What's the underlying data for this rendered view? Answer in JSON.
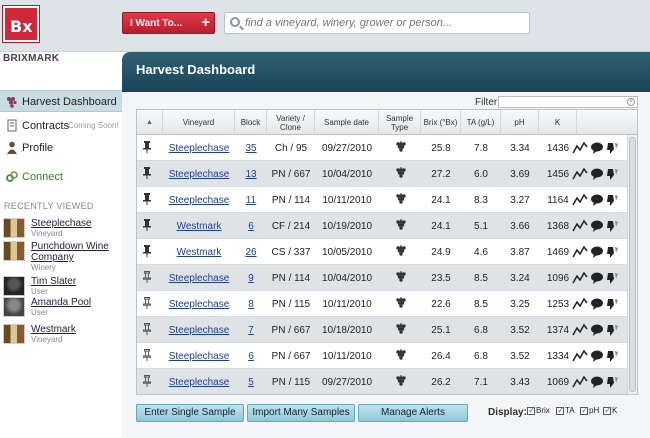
{
  "app": {
    "logo_text": "Bx",
    "brand": "BRIXMARK"
  },
  "topbar": {
    "i_want_label": "I Want To...",
    "i_want_plus": "+",
    "search_placeholder": "find a vineyard, winery, grower or person..."
  },
  "sidebar": {
    "items": [
      {
        "label": "Harvest Dashboard",
        "active": true,
        "icon": "grape-icon"
      },
      {
        "label": "Contracts",
        "badge": "Coming Soon!",
        "icon": "document-icon"
      },
      {
        "label": "Profile",
        "icon": "person-icon"
      },
      {
        "label": "Connect",
        "icon": "link-icon"
      }
    ],
    "recently_viewed_title": "RECENTLY VIEWED",
    "recent": [
      {
        "name": "Steeplechase",
        "type": "Vineyard"
      },
      {
        "name": "Punchdown Wine Company",
        "type": "Winery"
      },
      {
        "name": "Tim Slater",
        "type": "User"
      },
      {
        "name": "Amanda Pool",
        "type": "User"
      },
      {
        "name": "Westmark",
        "type": "Vineyard"
      }
    ]
  },
  "main": {
    "title": "Harvest Dashboard",
    "filter_label": "Filter:",
    "columns": [
      "Vineyard",
      "Block",
      "Variety / Clone",
      "Sample date",
      "Sample Type",
      "Brix (°Bx)",
      "TA (g/L)",
      "pH",
      "K"
    ],
    "rows": [
      {
        "pinned": true,
        "vineyard": "Steeplechase",
        "block": "35",
        "variety": "Ch / 95",
        "date": "09/27/2010",
        "brix": "25.8",
        "ta": "7.8",
        "ph": "3.34",
        "k": "1436"
      },
      {
        "pinned": true,
        "vineyard": "Steeplechase",
        "block": "13",
        "variety": "PN / 667",
        "date": "10/04/2010",
        "brix": "27.2",
        "ta": "6.0",
        "ph": "3.69",
        "k": "1456"
      },
      {
        "pinned": true,
        "vineyard": "Steeplechase",
        "block": "11",
        "variety": "PN / 114",
        "date": "10/11/2010",
        "brix": "24.1",
        "ta": "8.3",
        "ph": "3.27",
        "k": "1164"
      },
      {
        "pinned": true,
        "vineyard": "Westmark",
        "block": "6",
        "variety": "CF / 214",
        "date": "10/19/2010",
        "brix": "24.1",
        "ta": "5.1",
        "ph": "3.66",
        "k": "1368"
      },
      {
        "pinned": true,
        "vineyard": "Westmark",
        "block": "26",
        "variety": "CS / 337",
        "date": "10/05/2010",
        "brix": "24.9",
        "ta": "4.6",
        "ph": "3.87",
        "k": "1469"
      },
      {
        "pinned": false,
        "vineyard": "Steeplechase",
        "block": "9",
        "variety": "PN / 114",
        "date": "10/04/2010",
        "brix": "23.5",
        "ta": "8.5",
        "ph": "3.24",
        "k": "1096"
      },
      {
        "pinned": false,
        "vineyard": "Steeplechase",
        "block": "8",
        "variety": "PN / 115",
        "date": "10/11/2010",
        "brix": "22.6",
        "ta": "8.5",
        "ph": "3.25",
        "k": "1253"
      },
      {
        "pinned": false,
        "vineyard": "Steeplechase",
        "block": "7",
        "variety": "PN / 667",
        "date": "10/18/2010",
        "brix": "25.1",
        "ta": "6.8",
        "ph": "3.52",
        "k": "1374"
      },
      {
        "pinned": false,
        "vineyard": "Steeplechase",
        "block": "6",
        "variety": "PN / 667",
        "date": "10/11/2010",
        "brix": "26.4",
        "ta": "6.8",
        "ph": "3.52",
        "k": "1334"
      },
      {
        "pinned": false,
        "vineyard": "Steeplechase",
        "block": "5",
        "variety": "PN / 115",
        "date": "09/27/2010",
        "brix": "26.2",
        "ta": "7.1",
        "ph": "3.43",
        "k": "1069"
      }
    ],
    "buttons": [
      "Enter Single Sample",
      "Import Many Samples",
      "Manage Alerts"
    ],
    "display_label": "Display:",
    "display_options": [
      "Brix",
      "TA",
      "pH",
      "K"
    ]
  },
  "colors": {
    "brand_red": "#d0283a",
    "header_teal": "#1c4558",
    "button_cyan": "#8ec8d8",
    "link_blue": "#1f3f8f"
  }
}
